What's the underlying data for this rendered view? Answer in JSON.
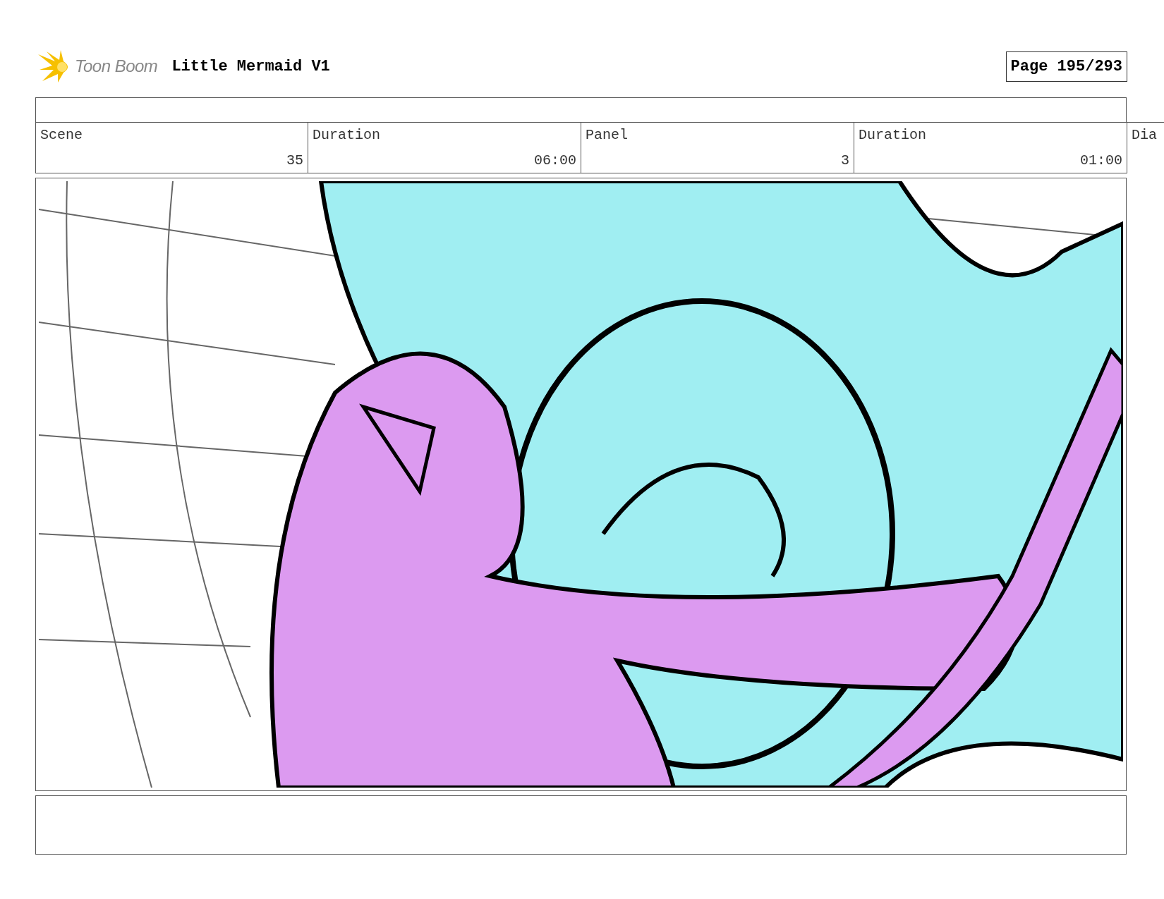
{
  "header": {
    "logo_text": "Toon Boom",
    "project_title": "Little Mermaid V1",
    "page": "Page 195/293"
  },
  "info_fields": [
    {
      "heading": "Scene",
      "entry": "35"
    },
    {
      "heading": "Duration",
      "entry": "06:00"
    },
    {
      "heading": "Panel",
      "entry": "3"
    },
    {
      "heading": "Duration",
      "entry": "01:00"
    },
    {
      "heading": "Dia"
    }
  ]
}
